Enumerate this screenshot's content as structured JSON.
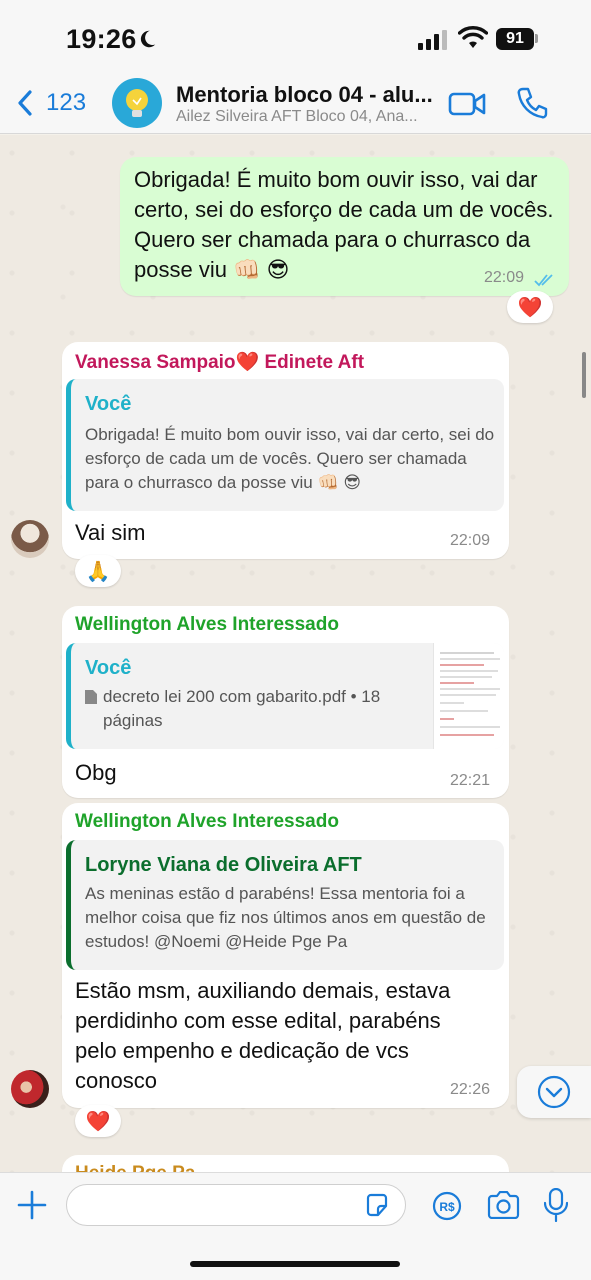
{
  "status_bar": {
    "time": "19:26",
    "battery": "91"
  },
  "header": {
    "back_label": "123",
    "title": "Mentoria bloco 04 - alu...",
    "subtitle": "Ailez Silveira AFT Bloco 04, Ana..."
  },
  "messages": {
    "m1": {
      "text": "Obrigada! É muito bom ouvir isso, vai dar certo, sei do esforço de cada um de vocês. Quero ser chamada para o churrasco da posse viu 👊🏻 😎",
      "time": "22:09",
      "reaction": "❤️"
    },
    "m2": {
      "sender": "Vanessa Sampaio❤️ Edinete Aft",
      "quote_name": "Você",
      "quote_text": "Obrigada! É muito bom ouvir isso, vai dar certo, sei do esforço de cada um de vocês. Quero ser chamada para o churrasco da posse viu 👊🏻 😎",
      "text": "Vai sim",
      "time": "22:09",
      "reaction": "🙏"
    },
    "m3": {
      "sender": "Wellington Alves Interessado",
      "quote_name": "Você",
      "quote_text": "decreto lei 200 com gabarito.pdf • 18 páginas",
      "text": "Obg",
      "time": "22:21"
    },
    "m4": {
      "sender": "Wellington Alves Interessado",
      "quote_name": "Loryne Viana de Oliveira AFT",
      "quote_text": "As meninas estão d parabéns! Essa mentoria foi a melhor coisa que fiz nos últimos anos em questão de estudos! @Noemi @Heide Pge Pa",
      "text": "Estão msm, auxiliando demais, estava perdidinho com esse edital, parabéns pelo empenho e dedicação de vcs conosco",
      "time": "22:26",
      "reaction": "❤️"
    },
    "m5": {
      "sender": "Heide Pge Pa"
    }
  },
  "colors": {
    "outgoing_bubble": "#d9fdd3",
    "incoming_bubble": "#ffffff",
    "sender_vanessa": "#c2185b",
    "sender_wellington": "#1fa32a",
    "sender_heide": "#c98b1e",
    "quote_you": "#1fb1c9",
    "quote_loryne": "#0b6e2d",
    "accent": "#1a7cd9"
  },
  "icons": [
    "moon-icon",
    "signal-icon",
    "wifi-icon",
    "chevron-left-icon",
    "video-icon",
    "phone-icon",
    "plus-icon",
    "sticker-icon",
    "pix-icon",
    "camera-icon",
    "mic-icon",
    "chevron-down-icon",
    "double-check-icon",
    "document-icon"
  ]
}
